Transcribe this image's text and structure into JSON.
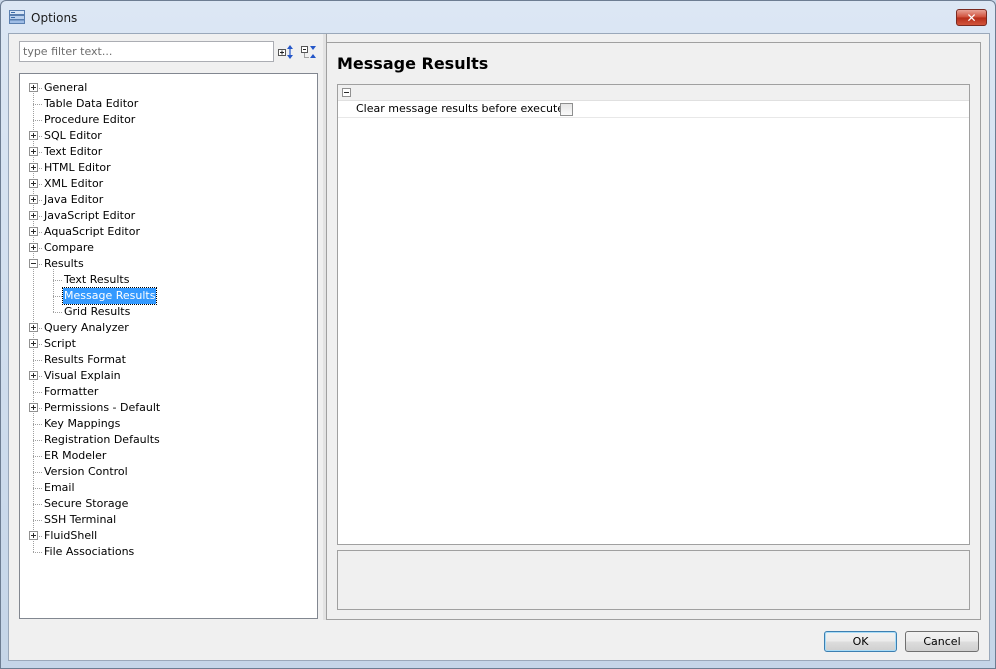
{
  "window": {
    "title": "Options",
    "close_label": "✕"
  },
  "filter": {
    "placeholder": "type filter text..."
  },
  "toolbar": {
    "expand_icon": "expand-all-icon",
    "collapse_icon": "collapse-all-icon"
  },
  "tree": {
    "items": [
      {
        "label": "General",
        "level": 0,
        "expander": "plus"
      },
      {
        "label": "Table Data Editor",
        "level": 0,
        "expander": "none"
      },
      {
        "label": "Procedure Editor",
        "level": 0,
        "expander": "none"
      },
      {
        "label": "SQL Editor",
        "level": 0,
        "expander": "plus"
      },
      {
        "label": "Text Editor",
        "level": 0,
        "expander": "plus"
      },
      {
        "label": "HTML Editor",
        "level": 0,
        "expander": "plus"
      },
      {
        "label": "XML Editor",
        "level": 0,
        "expander": "plus"
      },
      {
        "label": "Java Editor",
        "level": 0,
        "expander": "plus"
      },
      {
        "label": "JavaScript Editor",
        "level": 0,
        "expander": "plus"
      },
      {
        "label": "AquaScript Editor",
        "level": 0,
        "expander": "plus"
      },
      {
        "label": "Compare",
        "level": 0,
        "expander": "plus"
      },
      {
        "label": "Results",
        "level": 0,
        "expander": "minus"
      },
      {
        "label": "Text Results",
        "level": 1,
        "expander": "none"
      },
      {
        "label": "Message Results",
        "level": 1,
        "expander": "none",
        "selected": true
      },
      {
        "label": "Grid Results",
        "level": 1,
        "expander": "none"
      },
      {
        "label": "Query Analyzer",
        "level": 0,
        "expander": "plus"
      },
      {
        "label": "Script",
        "level": 0,
        "expander": "plus"
      },
      {
        "label": "Results Format",
        "level": 0,
        "expander": "none"
      },
      {
        "label": "Visual Explain",
        "level": 0,
        "expander": "plus"
      },
      {
        "label": "Formatter",
        "level": 0,
        "expander": "none"
      },
      {
        "label": "Permissions - Default",
        "level": 0,
        "expander": "plus"
      },
      {
        "label": "Key Mappings",
        "level": 0,
        "expander": "none"
      },
      {
        "label": "Registration Defaults",
        "level": 0,
        "expander": "none"
      },
      {
        "label": "ER Modeler",
        "level": 0,
        "expander": "none"
      },
      {
        "label": "Version Control",
        "level": 0,
        "expander": "none"
      },
      {
        "label": "Email",
        "level": 0,
        "expander": "none"
      },
      {
        "label": "Secure Storage",
        "level": 0,
        "expander": "none"
      },
      {
        "label": "SSH Terminal",
        "level": 0,
        "expander": "none"
      },
      {
        "label": "FluidShell",
        "level": 0,
        "expander": "plus"
      },
      {
        "label": "File Associations",
        "level": 0,
        "expander": "none"
      }
    ]
  },
  "page": {
    "title": "Message Results",
    "properties": [
      {
        "label": "Clear message results before execute",
        "checked": false
      }
    ]
  },
  "buttons": {
    "ok": "OK",
    "cancel": "Cancel"
  }
}
